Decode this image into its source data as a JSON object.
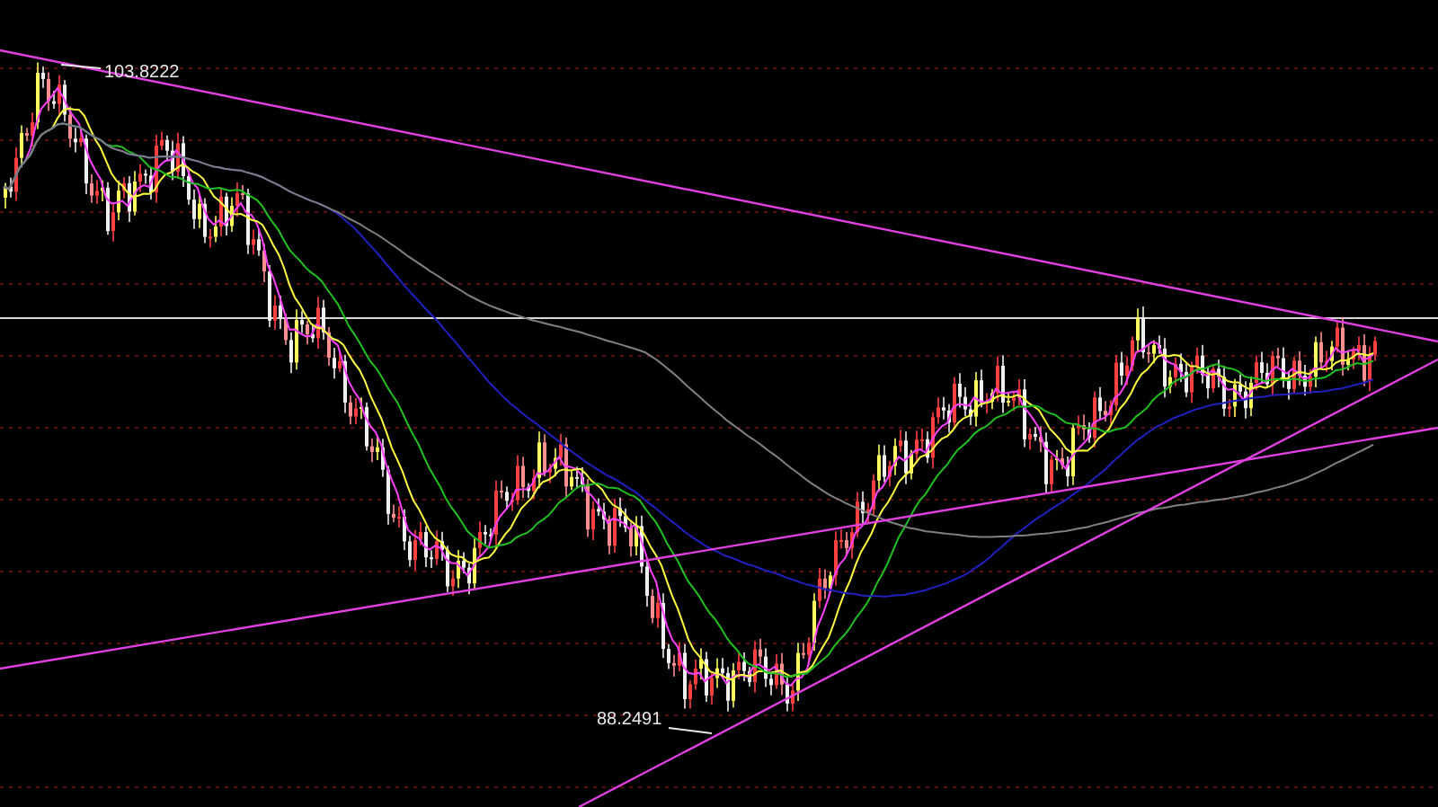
{
  "chart": {
    "high_label": "103.8222",
    "low_label": "88.2491"
  }
}
